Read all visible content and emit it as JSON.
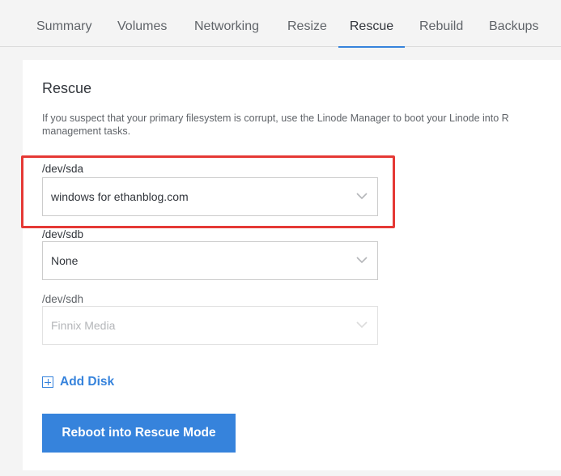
{
  "tabs": [
    {
      "label": "Summary",
      "active": false
    },
    {
      "label": "Volumes",
      "active": false
    },
    {
      "label": "Networking",
      "active": false
    },
    {
      "label": "Resize",
      "active": false
    },
    {
      "label": "Rescue",
      "active": true
    },
    {
      "label": "Rebuild",
      "active": false
    },
    {
      "label": "Backups",
      "active": false
    }
  ],
  "rescue": {
    "title": "Rescue",
    "description_line1": "If you suspect that your primary filesystem is corrupt, use the Linode Manager to boot your Linode into R",
    "description_line2": "management tasks.",
    "fields": [
      {
        "label": "/dev/sda",
        "value": "windows for ethanblog.com",
        "disabled": false
      },
      {
        "label": "/dev/sdb",
        "value": "None",
        "disabled": false
      },
      {
        "label": "/dev/sdh",
        "value": "Finnix Media",
        "disabled": true
      }
    ],
    "add_disk_label": "Add Disk",
    "reboot_button_label": "Reboot into Rescue Mode"
  },
  "colors": {
    "accent": "#3683dc",
    "highlight": "#e53935"
  },
  "icons": {
    "select_arrow": "chevron-down-icon",
    "add": "plus-box-icon"
  }
}
